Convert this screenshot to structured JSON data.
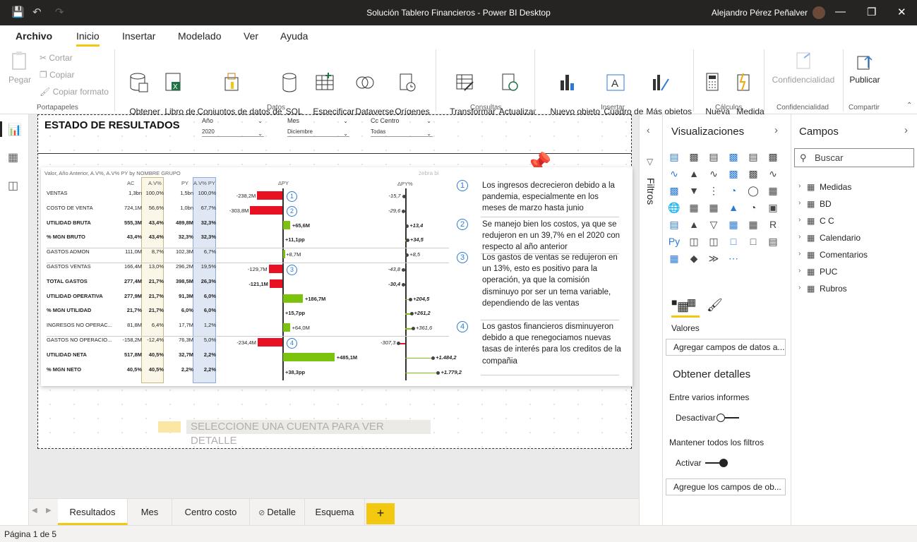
{
  "window": {
    "title": "Solución Tablero Financieros - Power BI Desktop",
    "user": "Alejandro Pérez Peñalver"
  },
  "menu": [
    "Archivo",
    "Inicio",
    "Insertar",
    "Modelado",
    "Ver",
    "Ayuda"
  ],
  "ribbon": {
    "paste": "Pegar",
    "cut": "Cortar",
    "copy": "Copiar",
    "format_painter": "Copiar formato",
    "get_data": "Obtener\ndatos",
    "excel": "Libro de\nExcel",
    "datasets": "Conjuntos de datos de\nPower BI",
    "sql": "SQL\nServer",
    "enter_data": "Especificar\ndatos",
    "dataverse": "Dataverse",
    "recent": "Orígenes\nrecientes",
    "transform": "Transformar\ndatos",
    "refresh": "Actualizar",
    "new_visual": "Nuevo objeto\nvisual",
    "textbox": "Cuadro de\ntexto",
    "more_visuals": "Más objetos\nvisuales",
    "new_measure": "Nueva\nmedida",
    "quick_measure": "Medida\nrápida",
    "sensitivity": "Confidencialidad",
    "publish": "Publicar",
    "groups": [
      "Portapapeles",
      "Datos",
      "Consultas",
      "Insertar",
      "Cálculos",
      "Confidencialidad",
      "Compartir"
    ]
  },
  "report": {
    "title": "ESTADO DE RESULTADOS",
    "slicers": [
      {
        "label": "Año",
        "value": "2020"
      },
      {
        "label": "Mes",
        "value": "Diciembre"
      },
      {
        "label": "Cc Centro",
        "value": "Todas"
      }
    ],
    "visual_header": "Valor, Año Anterior, A.V%, A.V% PY by NOMBRE GRUPO",
    "zebra": "zebra bi",
    "col_headers": {
      "ac": "AC",
      "av": "A.V%",
      "py": "PY",
      "avpy": "A.V% PY",
      "dpy": "ΔPY",
      "dpyp": "ΔPY%"
    },
    "rows": [
      {
        "name": "VENTAS",
        "ac": "1,3bn",
        "av": "100,0%",
        "py": "1,5bn",
        "avpy": "100,0%",
        "d": "-238,2M",
        "dp": "-15,7",
        "bold": false
      },
      {
        "name": "COSTO DE VENTA",
        "ac": "724,1M",
        "av": "56,6%",
        "py": "1,0bn",
        "avpy": "67,7%",
        "d": "-303,8M",
        "dp": "-29,6",
        "bold": false
      },
      {
        "name": "UTILIDAD BRUTA",
        "ac": "555,3M",
        "av": "43,4%",
        "py": "489,8M",
        "avpy": "32,3%",
        "d": "+65,6M",
        "dp": "+13,4",
        "bold": true
      },
      {
        "name": "% MGN BRUTO",
        "ac": "43,4%",
        "av": "43,4%",
        "py": "32,3%",
        "avpy": "32,3%",
        "d": "+11,1pp",
        "dp": "+34,5",
        "bold": true
      },
      {
        "name": "GASTOS ADMON",
        "ac": "111,0M",
        "av": "8,7%",
        "py": "102,3M",
        "avpy": "6,7%",
        "d": "+8,7M",
        "dp": "+8,5",
        "bold": false
      },
      {
        "name": "GASTOS VENTAS",
        "ac": "166,4M",
        "av": "13,0%",
        "py": "296,2M",
        "avpy": "19,5%",
        "d": "-129,7M",
        "dp": "-43,8",
        "bold": false
      },
      {
        "name": "TOTAL GASTOS",
        "ac": "277,4M",
        "av": "21,7%",
        "py": "398,5M",
        "avpy": "26,3%",
        "d": "-121,1M",
        "dp": "-30,4",
        "bold": true
      },
      {
        "name": "UTILIDAD OPERATIVA",
        "ac": "277,9M",
        "av": "21,7%",
        "py": "91,3M",
        "avpy": "6,0%",
        "d": "+186,7M",
        "dp": "+204,5",
        "bold": true
      },
      {
        "name": "% MGN UTILIDAD",
        "ac": "21,7%",
        "av": "21,7%",
        "py": "6,0%",
        "avpy": "6,0%",
        "d": "+15,7pp",
        "dp": "+261,2",
        "bold": true
      },
      {
        "name": "INGRESOS NO OPERAC...",
        "ac": "81,8M",
        "av": "6,4%",
        "py": "17,7M",
        "avpy": "1,2%",
        "d": "+64,0M",
        "dp": "+361,6",
        "bold": false
      },
      {
        "name": "GASTOS NO OPERACIO...",
        "ac": "-158,2M",
        "av": "-12,4%",
        "py": "76,3M",
        "avpy": "5,0%",
        "d": "-234,4M",
        "dp": "-307,3",
        "bold": false
      },
      {
        "name": "UTILIDAD NETA",
        "ac": "517,8M",
        "av": "40,5%",
        "py": "32,7M",
        "avpy": "2,2%",
        "d": "+485,1M",
        "dp": "+1.484,2",
        "bold": true
      },
      {
        "name": "% MGN NETO",
        "ac": "40,5%",
        "av": "40,5%",
        "py": "2,2%",
        "avpy": "2,2%",
        "d": "+38,3pp",
        "dp": "+1.779,2",
        "bold": true
      }
    ],
    "markers": [
      "1",
      "2",
      "3",
      "4"
    ],
    "comments": [
      {
        "n": "1",
        "text": "Los ingresos decrecieron debido a la pandemia, especialmente en los meses de marzo hasta junio"
      },
      {
        "n": "2",
        "text": "Se manejo bien los costos, ya que se redujeron en un 39,7% en el 2020 con respecto al año anterior"
      },
      {
        "n": "3",
        "text": "Los gastos de ventas se redujeron en un 13%, esto es positivo para la operación, ya que la comisión disminuyo por ser un tema variable, dependiendo de las ventas"
      },
      {
        "n": "4",
        "text": "Los gastos financieros disminuyeron debido a que renegociamos nuevas tasas de interés para los creditos de la compañia"
      }
    ],
    "detail_banner": "SELECCIONE UNA CUENTA PARA VER DETALLE"
  },
  "page_tabs": [
    "Resultados",
    "Mes",
    "Centro costo",
    "Detalle",
    "Esquema"
  ],
  "status": "Página 1 de 5",
  "filters_label": "Filtros",
  "viz_pane": {
    "title": "Visualizaciones",
    "values_label": "Valores",
    "add_fields": "Agregar campos de datos a...",
    "drill_title": "Obtener detalles",
    "cross_report": "Entre varios informes",
    "off": "Desactivar",
    "keep_filters": "Mantener todos los filtros",
    "on": "Activar",
    "add_drill": "Agregue los campos de ob..."
  },
  "fields_pane": {
    "title": "Campos",
    "search_placeholder": "Buscar",
    "tables": [
      "Medidas",
      "BD",
      "C C",
      "Calendario",
      "Comentarios",
      "PUC",
      "Rubros"
    ]
  },
  "colors": {
    "accent": "#f2c811",
    "positive": "#7cc30e",
    "negative": "#e81123",
    "titlebar": "#252423"
  }
}
